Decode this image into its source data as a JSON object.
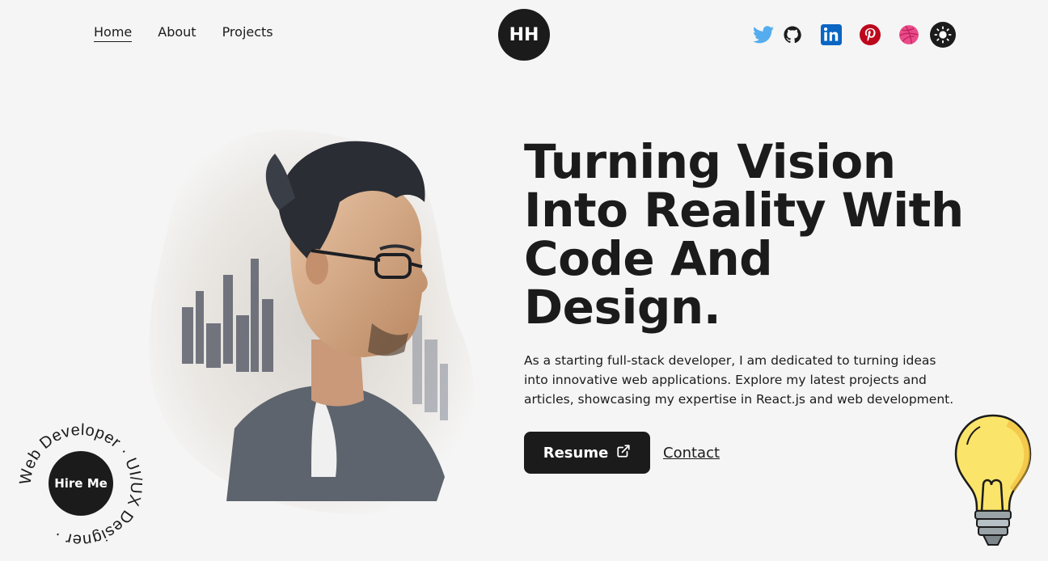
{
  "nav": {
    "items": [
      {
        "label": "Home",
        "active": true
      },
      {
        "label": "About",
        "active": false
      },
      {
        "label": "Projects",
        "active": false
      }
    ]
  },
  "logo": {
    "text": "HH"
  },
  "socials": [
    "twitter-icon",
    "github-icon",
    "linkedin-icon",
    "pinterest-icon",
    "dribbble-icon",
    "theme-toggle-icon"
  ],
  "colors": {
    "background": "#f5f5f5",
    "dark": "#1b1b1b",
    "twitter": "#55acee",
    "linkedin": "#0a66c2",
    "pinterest": "#bd081c",
    "dribbble": "#ea4c89"
  },
  "hero": {
    "headline": "Turning Vision Into Reality With Code And Design.",
    "description": "As a starting full-stack developer, I am dedicated to turning ideas into innovative web applications. Explore my latest projects and articles, showcasing my expertise in React.js and web development.",
    "resume_label": "Resume",
    "contact_label": "Contact"
  },
  "hire": {
    "label": "Hire Me",
    "ring_text": "Web Developer · UI/UX Designer ·"
  }
}
